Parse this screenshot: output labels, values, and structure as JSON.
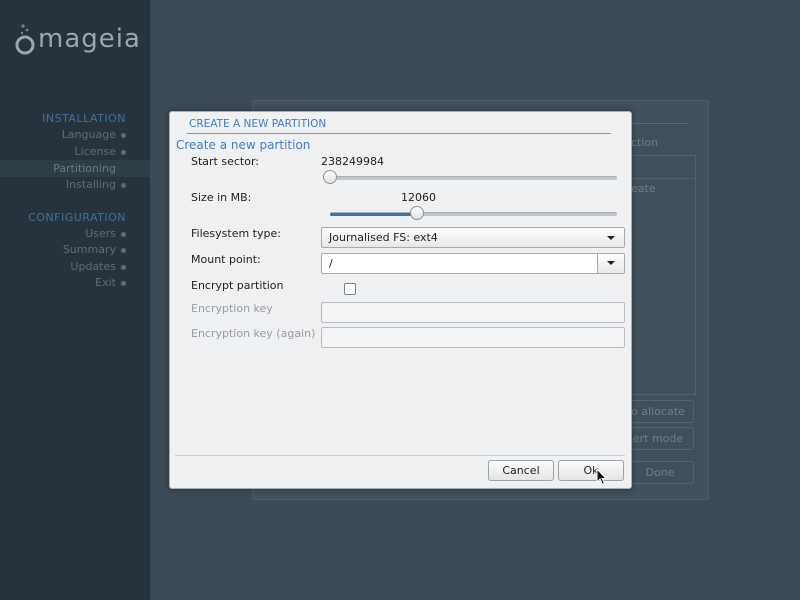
{
  "sidebar": {
    "logo_text": "mageia",
    "sections": [
      {
        "heading": "INSTALLATION",
        "items": [
          {
            "label": "Language"
          },
          {
            "label": "License"
          },
          {
            "label": "Partitioning"
          },
          {
            "label": "Installing"
          }
        ]
      },
      {
        "heading": "CONFIGURATION",
        "items": [
          {
            "label": "Users"
          },
          {
            "label": "Summary"
          },
          {
            "label": "Updates"
          },
          {
            "label": "Exit"
          }
        ]
      }
    ]
  },
  "background": {
    "frag_ction": "ction",
    "frag_eate": "eate",
    "btn_allocate": "o allocate",
    "btn_mode": "ert mode",
    "btn_done": "Done"
  },
  "dialog": {
    "title": "CREATE A NEW PARTITION",
    "heading": "Create a new partition",
    "start_sector": {
      "label": "Start sector:",
      "value": "238249984"
    },
    "size": {
      "label": "Size in MB:",
      "value": "12060"
    },
    "filesystem": {
      "label": "Filesystem type:",
      "value": "Journalised FS: ext4"
    },
    "mount": {
      "label": "Mount point:",
      "value": "/"
    },
    "encrypt": {
      "label": "Encrypt partition",
      "checked": false
    },
    "encryption_key": {
      "label": "Encryption key",
      "value": ""
    },
    "encryption_key_again": {
      "label": "Encryption key (again)",
      "value": ""
    },
    "cancel_label": "Cancel",
    "ok_label": "Ok"
  },
  "colors": {
    "accent": "#3f7ec2",
    "sidebar_bg": "#27343d",
    "desktop_bg": "#3c4a55"
  }
}
